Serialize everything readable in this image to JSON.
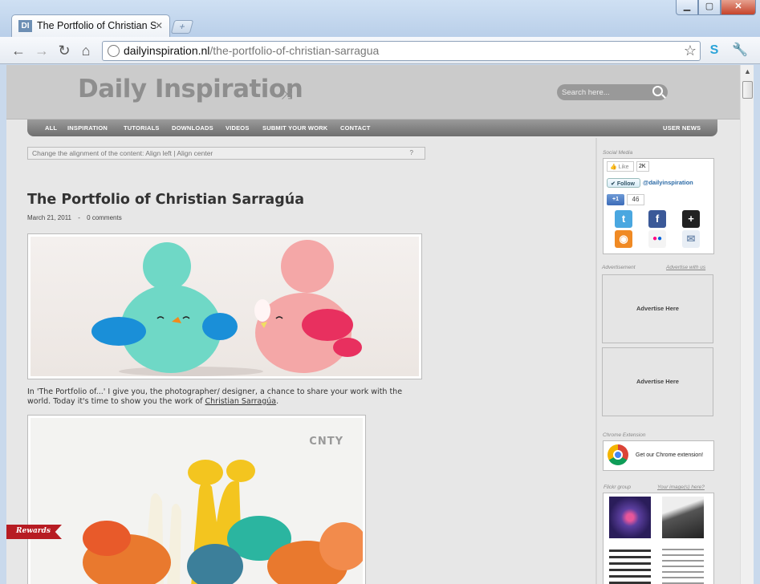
{
  "browser": {
    "tab_title": "The Portfolio of Christian S",
    "favicon_text": "DI",
    "url_domain": "dailyinspiration.nl",
    "url_path": "/the-portfolio-of-christian-sarragua"
  },
  "site": {
    "logo": "Daily Inspiration",
    "search_placeholder": "Search here...",
    "nav": [
      "ALL",
      "INSPIRATION",
      "TUTORIALS",
      "DOWNLOADS",
      "VIDEOS",
      "SUBMIT YOUR WORK",
      "CONTACT"
    ],
    "nav_right": "USER NEWS",
    "align_bar": "Change the alignment of the content: Align left | Align center",
    "align_help": "?"
  },
  "post": {
    "title": "The Portfolio of Christian Sarragúa",
    "date": "March 21, 2011",
    "separator": "-",
    "comments": "0 comments",
    "text_before": "In 'The Portfolio of...' I give you, the photographer/ designer, a chance to share your work with the world. Today it's time to show you the work of ",
    "link": "Christian Sarragúa",
    "text_after": ".",
    "image2_watermark": "CNTY"
  },
  "sidebar": {
    "social_label": "Social Media",
    "like_label": "Like",
    "like_count": "2K",
    "follow_label": "Follow",
    "follow_handle": "@dailyinspiration",
    "plus_label": "+1",
    "plus_count": "46",
    "ad_label": "Advertisement",
    "ad_link": "Advertise with us",
    "ad_box_1": "Advertise Here",
    "ad_box_2": "Advertise Here",
    "chrome_label": "Chrome Extension",
    "chrome_text": "Get our Chrome extension!",
    "flickr_label": "Flickr group",
    "flickr_link": "Your image(s) here?"
  },
  "rewards": "Rewards"
}
